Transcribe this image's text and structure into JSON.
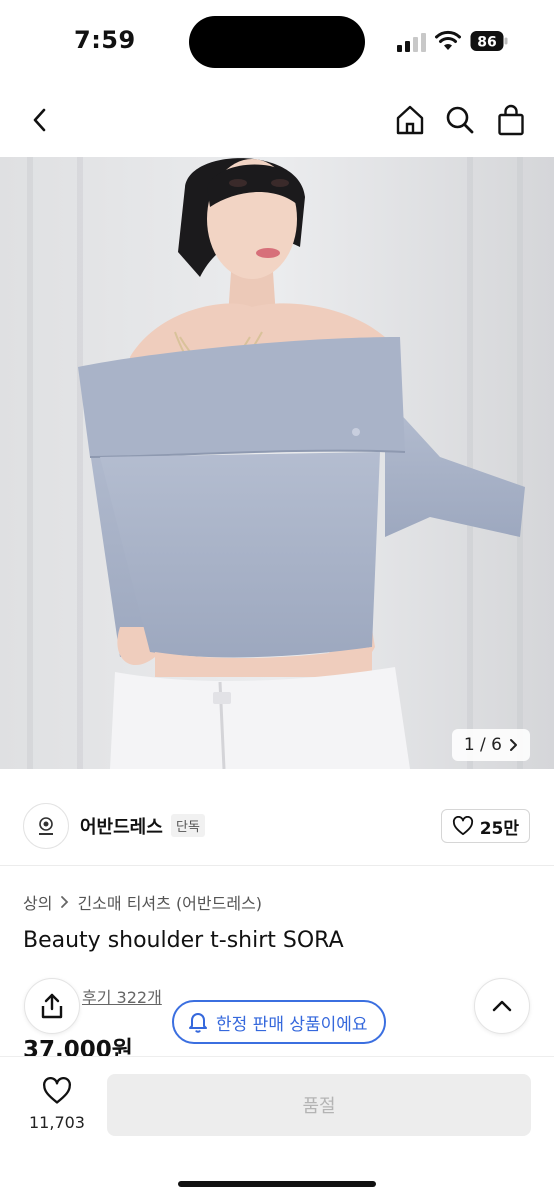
{
  "status_bar": {
    "time": "7:59",
    "battery": "86"
  },
  "nav": {
    "back_icon": "chevron-left-icon",
    "home_icon": "home-icon",
    "search_icon": "search-icon",
    "cart_icon": "shopping-bag-icon"
  },
  "gallery": {
    "current": 1,
    "total": 6,
    "counter_text": "1 / 6"
  },
  "seller": {
    "name": "어반드레스",
    "badge": "단독",
    "likes": "25만"
  },
  "product": {
    "breadcrumb": [
      "상의",
      "긴소매 티셔츠 (어반드레스)"
    ],
    "title": "Beauty shoulder t-shirt SORA",
    "reviews": "후기 322개",
    "price": "37,000원"
  },
  "banner": {
    "limited": "한정 판매 상품이에요"
  },
  "bottom": {
    "wish_count": "11,703",
    "purchase_label": "품절"
  },
  "colors": {
    "accent": "#3568dc",
    "disabled_bg": "#ededed",
    "disabled_text": "#b4b4b4",
    "top_color": "#a7b1c6"
  }
}
